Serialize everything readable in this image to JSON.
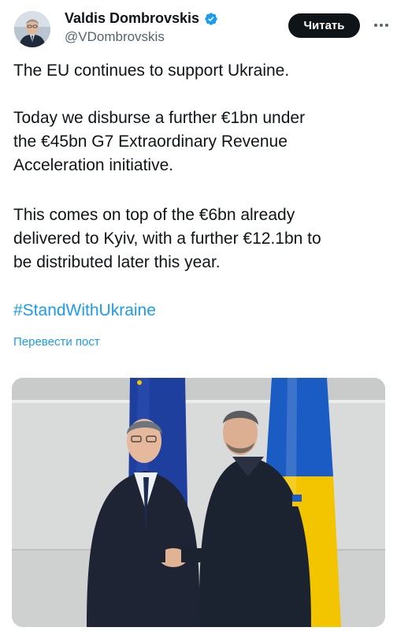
{
  "author": {
    "name": "Valdis Dombrovskis",
    "handle": "@VDombrovskis",
    "verified": true,
    "verified_color": "#1d9bf0"
  },
  "actions": {
    "follow_label": "Читать",
    "more_icon": "more-horizontal-icon"
  },
  "tweet": {
    "paragraph1": "The EU continues to support Ukraine.",
    "paragraph2_line1": "Today we disburse a further €1bn under",
    "paragraph2_line2": "the €45bn G7 Extraordinary Revenue",
    "paragraph2_line3": "Acceleration initiative.",
    "paragraph3_line1": "This comes on top of the €6bn already",
    "paragraph3_line2": "delivered to Kyiv, with a further €12.1bn to",
    "paragraph3_line3": "be distributed later this year.",
    "hashtag": "#StandWithUkraine",
    "translate_link": "Перевести пост"
  },
  "colors": {
    "text": "#0f1419",
    "secondary": "#536471",
    "link": "#1d9bf0",
    "eu_blue": "#1f3f9e",
    "ukraine_blue": "#1b5cc4",
    "ukraine_yellow": "#f2c500"
  }
}
